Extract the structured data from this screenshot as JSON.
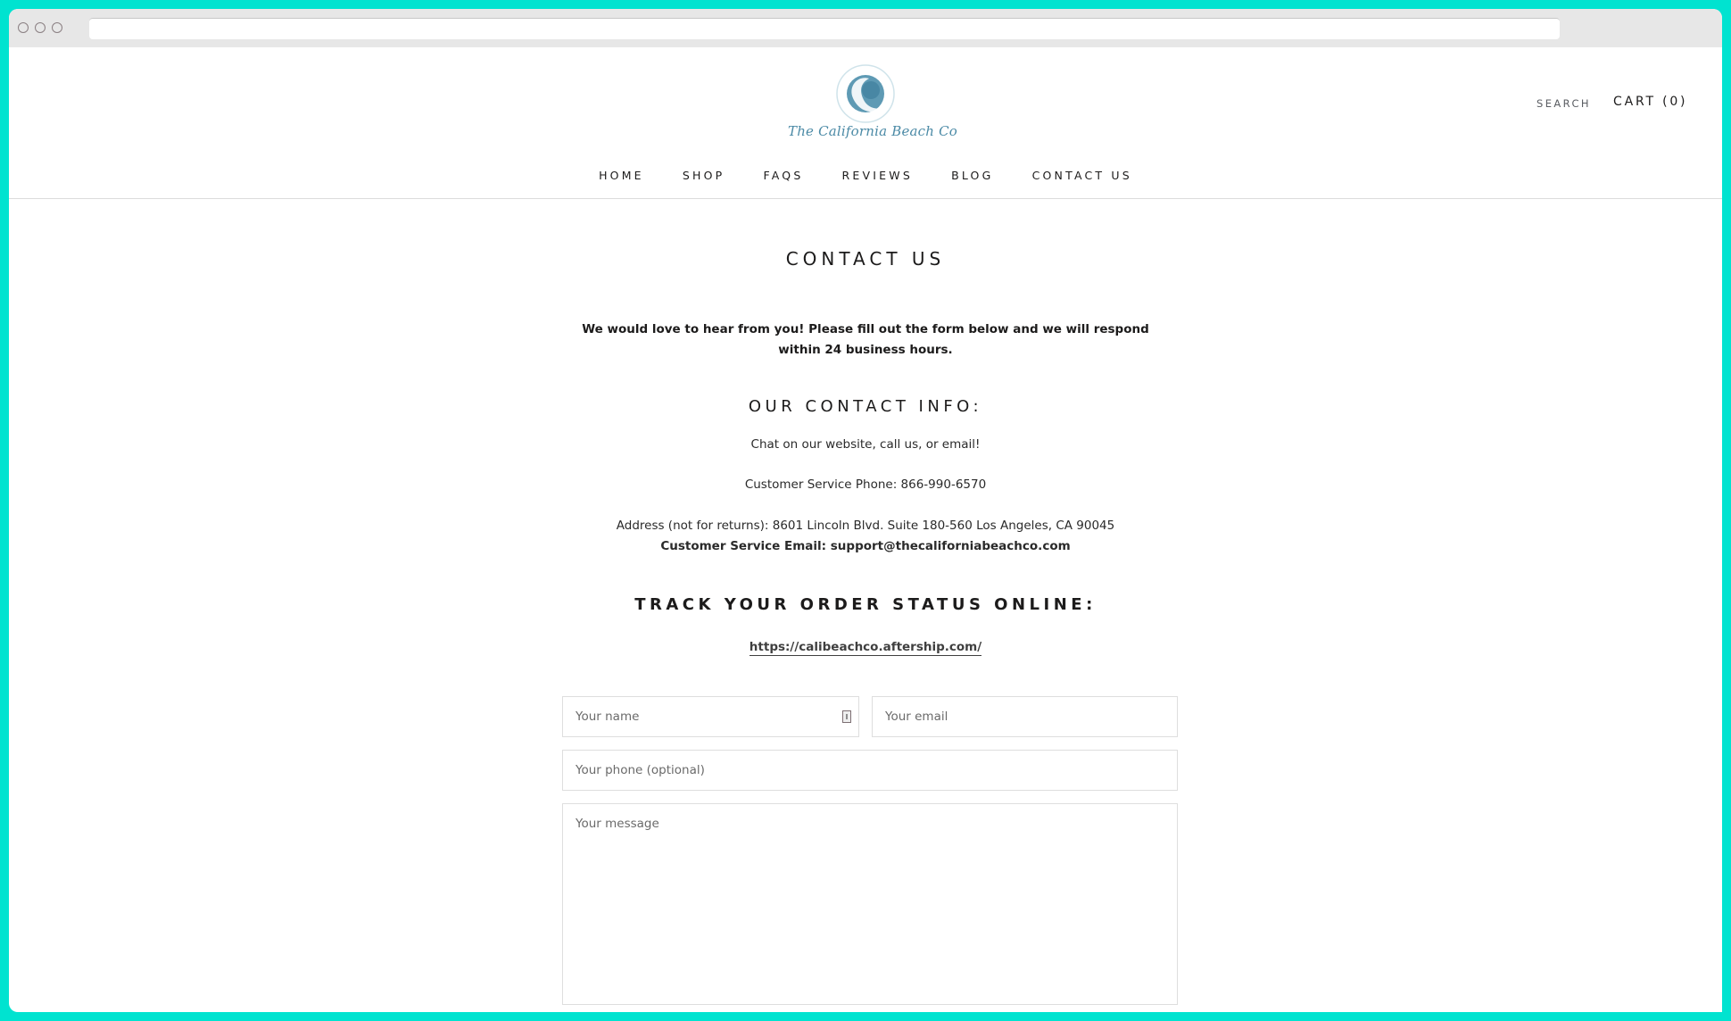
{
  "browser": {
    "address_bar_value": ""
  },
  "header": {
    "logo_text": "The California Beach Co",
    "search_label": "SEARCH",
    "cart_label": "CART (0)"
  },
  "nav": {
    "items": [
      {
        "label": "HOME"
      },
      {
        "label": "SHOP"
      },
      {
        "label": "FAQS"
      },
      {
        "label": "REVIEWS"
      },
      {
        "label": "BLOG"
      },
      {
        "label": "CONTACT US"
      }
    ]
  },
  "page": {
    "title": "CONTACT US",
    "intro": "We would love to hear from you! Please fill out the form below and we will respond within 24 business hours.",
    "contact_heading": "OUR CONTACT INFO:",
    "chat_text": "Chat on our website, call us, or email!",
    "phone_text": "Customer Service Phone: 866-990-6570",
    "address_text": "Address (not for returns): 8601 Lincoln Blvd. Suite 180-560 Los Angeles, CA 90045",
    "email_text": "Customer Service Email: support@thecaliforniabeachco.com",
    "track_heading": "TRACK YOUR ORDER STATUS ONLINE:",
    "track_link": "https://calibeachco.aftership.com/"
  },
  "form": {
    "name_placeholder": "Your name",
    "email_placeholder": "Your email",
    "phone_placeholder": "Your phone (optional)",
    "message_placeholder": "Your message"
  },
  "colors": {
    "frame": "#00e3d0",
    "logo_blue": "#4b8aa6",
    "text": "#1c1b1b"
  }
}
